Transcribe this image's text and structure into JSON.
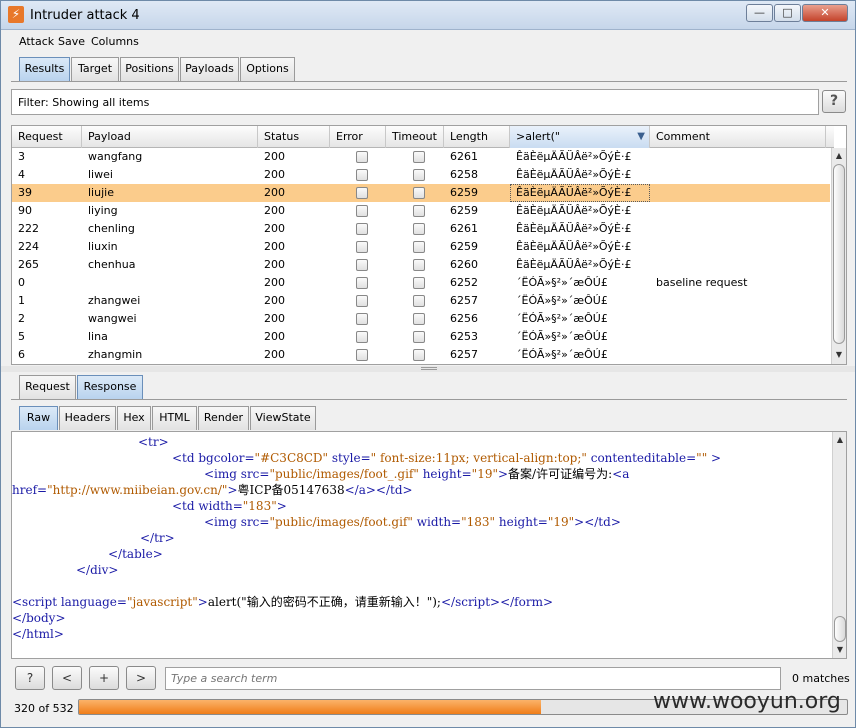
{
  "window": {
    "title": "Intruder attack 4",
    "controls": {
      "minimize": "—",
      "maximize": "□",
      "close": "✕"
    }
  },
  "menu": [
    "Attack",
    "Save",
    "Columns"
  ],
  "main_tabs": [
    "Results",
    "Target",
    "Positions",
    "Payloads",
    "Options"
  ],
  "filter": {
    "text": "Filter:  Showing all items",
    "help": "?"
  },
  "table": {
    "columns": [
      "Request",
      "Payload",
      "Status",
      "Error",
      "Timeout",
      "Length",
      ">alert(\"",
      "Comment"
    ],
    "sorted_column": ">alert(\"",
    "rows": [
      {
        "request": "3",
        "payload": "wangfang",
        "status": "200",
        "error": false,
        "timeout": false,
        "length": "6261",
        "grep": "ÊäÈëµÄÃÜÂë²»ÕýÈ·£",
        "comment": ""
      },
      {
        "request": "4",
        "payload": "liwei",
        "status": "200",
        "error": false,
        "timeout": false,
        "length": "6258",
        "grep": "ÊäÈëµÄÃÜÂë²»ÕýÈ·£",
        "comment": ""
      },
      {
        "request": "39",
        "payload": "liujie",
        "status": "200",
        "error": false,
        "timeout": false,
        "length": "6259",
        "grep": "ÊäÈëµÄÃÜÂë²»ÕýÈ·£",
        "comment": "",
        "selected": true
      },
      {
        "request": "90",
        "payload": "liying",
        "status": "200",
        "error": false,
        "timeout": false,
        "length": "6259",
        "grep": "ÊäÈëµÄÃÜÂë²»ÕýÈ·£",
        "comment": ""
      },
      {
        "request": "222",
        "payload": "chenling",
        "status": "200",
        "error": false,
        "timeout": false,
        "length": "6261",
        "grep": "ÊäÈëµÄÃÜÂë²»ÕýÈ·£",
        "comment": ""
      },
      {
        "request": "224",
        "payload": "liuxin",
        "status": "200",
        "error": false,
        "timeout": false,
        "length": "6259",
        "grep": "ÊäÈëµÄÃÜÂë²»ÕýÈ·£",
        "comment": ""
      },
      {
        "request": "265",
        "payload": "chenhua",
        "status": "200",
        "error": false,
        "timeout": false,
        "length": "6260",
        "grep": "ÊäÈëµÄÃÜÂë²»ÕýÈ·£",
        "comment": ""
      },
      {
        "request": "0",
        "payload": "",
        "status": "200",
        "error": false,
        "timeout": false,
        "length": "6252",
        "grep": "´ËÓÃ»§²»´æÔÚ£",
        "comment": "baseline request"
      },
      {
        "request": "1",
        "payload": "zhangwei",
        "status": "200",
        "error": false,
        "timeout": false,
        "length": "6257",
        "grep": "´ËÓÃ»§²»´æÔÚ£",
        "comment": ""
      },
      {
        "request": "2",
        "payload": "wangwei",
        "status": "200",
        "error": false,
        "timeout": false,
        "length": "6256",
        "grep": "´ËÓÃ»§²»´æÔÚ£",
        "comment": ""
      },
      {
        "request": "5",
        "payload": "lina",
        "status": "200",
        "error": false,
        "timeout": false,
        "length": "6253",
        "grep": "´ËÓÃ»§²»´æÔÚ£",
        "comment": ""
      },
      {
        "request": "6",
        "payload": "zhangmin",
        "status": "200",
        "error": false,
        "timeout": false,
        "length": "6257",
        "grep": "´ËÓÃ»§²»´æÔÚ£",
        "comment": ""
      }
    ]
  },
  "lower_tabs": [
    "Request",
    "Response"
  ],
  "view_tabs": [
    "Raw",
    "Headers",
    "Hex",
    "HTML",
    "Render",
    "ViewState"
  ],
  "code": {
    "l1": "<tr>",
    "l2a": "<td ",
    "l2b": "bgcolor",
    "l2c": "=",
    "l2d": "\"#C3C8CD\"",
    "l2e": " style",
    "l2f": "=",
    "l2g": "\" font-size:11px; vertical-align:top;\"",
    "l2h": " contenteditable",
    "l2i": "=",
    "l2j": "\"\"",
    "l2k": " >",
    "l3a": "<img ",
    "l3b": "src",
    "l3c": "=",
    "l3d": "\"public/images/foot_.gif\"",
    "l3e": " height",
    "l3f": "=",
    "l3g": "\"19\"",
    "l3h": ">",
    "l3i": "备案/许可证编号为:",
    "l3j": "<a",
    "l4a": "href",
    "l4b": "=",
    "l4c": "\"http://www.miibeian.gov.cn/\"",
    "l4d": ">",
    "l4e": "粤ICP备05147638",
    "l4f": "</a></td>",
    "l5a": "<td ",
    "l5b": "width",
    "l5c": "=",
    "l5d": "\"183\"",
    "l5e": ">",
    "l6a": "<img ",
    "l6b": "src",
    "l6c": "=",
    "l6d": "\"public/images/foot.gif\"",
    "l6e": " width",
    "l6f": "=",
    "l6g": "\"183\"",
    "l6h": " height",
    "l6i": "=",
    "l6j": "\"19\"",
    "l6k": "></td>",
    "l7": "</tr>",
    "l8": "</table>",
    "l9": "</div>",
    "l10a": "<script ",
    "l10b": "language",
    "l10c": "=",
    "l10d": "\"javascript\"",
    "l10e": ">",
    "l10f": "alert(\"输入的密码不正确，请重新输入！\");",
    "l10g": "</",
    "l10h": "script",
    "l10i": "></form>",
    "l11": "</body>",
    "l12": "</html>"
  },
  "bottom": {
    "help": "?",
    "prev": "<",
    "add": "+",
    "next": ">",
    "search_placeholder": "Type a search term",
    "matches": "0 matches"
  },
  "status": {
    "progress_label": "320 of 532",
    "progress_done": 320,
    "progress_total": 532
  },
  "watermark": "www.wooyun.org"
}
